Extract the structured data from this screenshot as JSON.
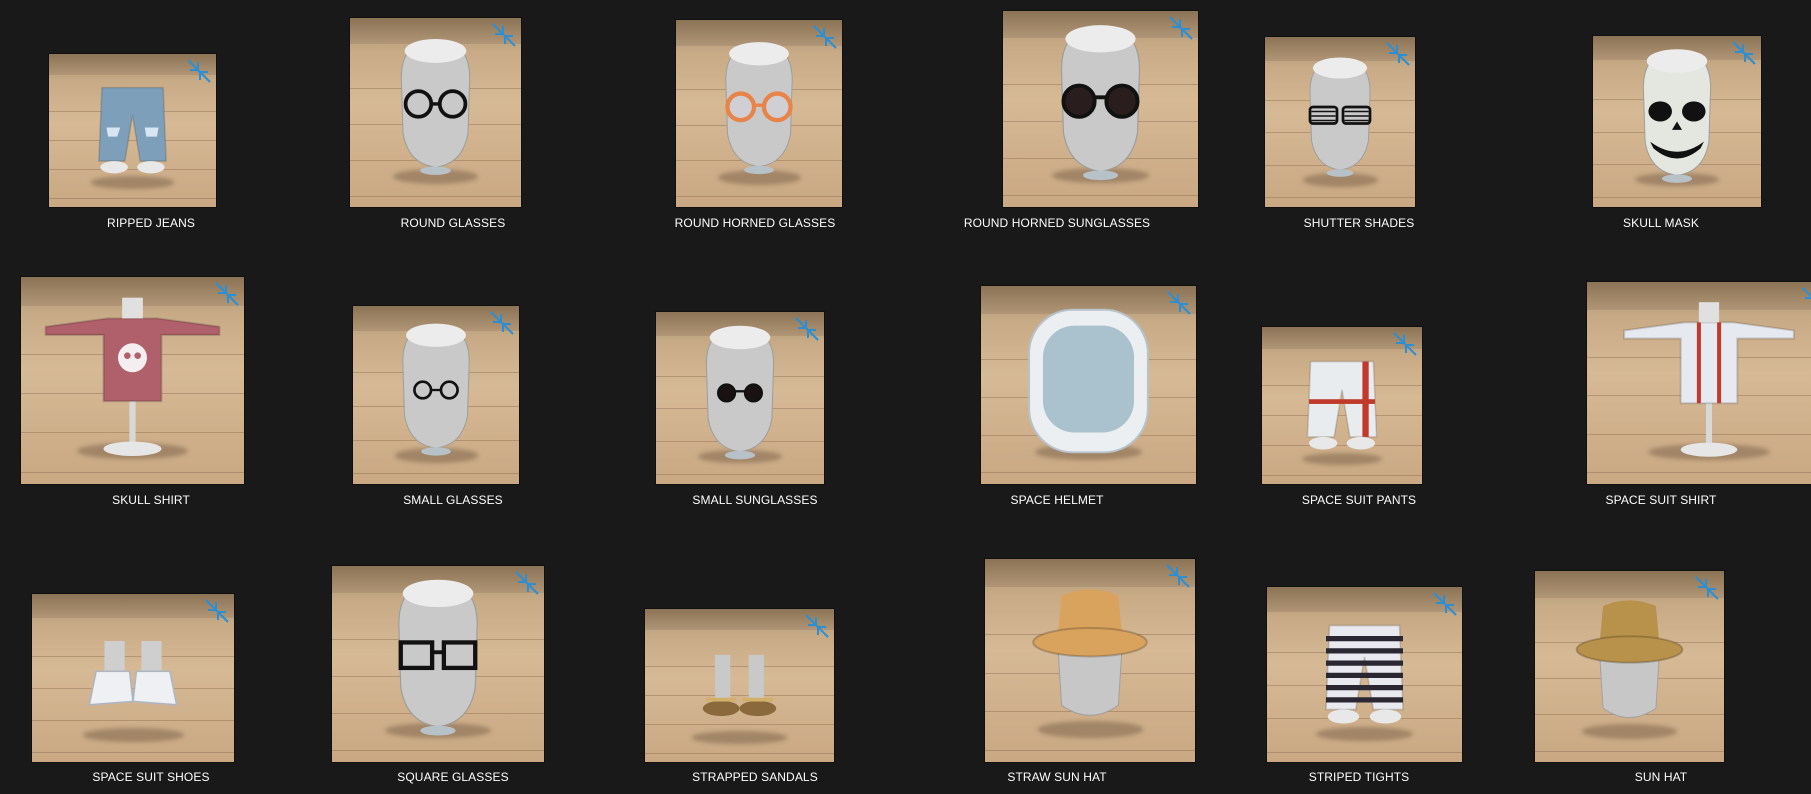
{
  "app": {
    "view": "file-explorer-thumbnail-grid",
    "badge_icon": "shrink-arrows-icon",
    "colors": {
      "background": "#191919",
      "label_text": "#ffffff",
      "badge": "#2b8fd6",
      "floor": "#d6b995"
    }
  },
  "items": [
    {
      "label": "RIPPED JEANS",
      "kind": "pants",
      "variant": "jeans",
      "icon": "ripped-jeans-thumbnail"
    },
    {
      "label": "ROUND GLASSES",
      "kind": "head",
      "variant": "round-glasses",
      "icon": "round-glasses-thumbnail"
    },
    {
      "label": "ROUND HORNED GLASSES",
      "kind": "head",
      "variant": "horned-glasses",
      "icon": "round-horned-glasses-thumbnail"
    },
    {
      "label": "ROUND HORNED SUNGLASSES",
      "kind": "head",
      "variant": "horned-sunglasses",
      "icon": "round-horned-sunglasses-thumbnail"
    },
    {
      "label": "SHUTTER SHADES",
      "kind": "head",
      "variant": "shutter",
      "icon": "shutter-shades-thumbnail"
    },
    {
      "label": "SKULL MASK",
      "kind": "head",
      "variant": "skull",
      "icon": "skull-mask-thumbnail"
    },
    {
      "label": "SKULL SHIRT",
      "kind": "shirt",
      "variant": "skull-shirt",
      "icon": "skull-shirt-thumbnail"
    },
    {
      "label": "SMALL GLASSES",
      "kind": "head",
      "variant": "small-glasses",
      "icon": "small-glasses-thumbnail"
    },
    {
      "label": "SMALL SUNGLASSES",
      "kind": "head",
      "variant": "small-sunglasses",
      "icon": "small-sunglasses-thumbnail"
    },
    {
      "label": "SPACE HELMET",
      "kind": "helmet",
      "variant": "helmet",
      "icon": "space-helmet-thumbnail"
    },
    {
      "label": "SPACE SUIT PANTS",
      "kind": "pants",
      "variant": "space-pants",
      "icon": "space-suit-pants-thumbnail"
    },
    {
      "label": "SPACE SUIT SHIRT",
      "kind": "shirt",
      "variant": "space-shirt",
      "icon": "space-suit-shirt-thumbnail"
    },
    {
      "label": "SPACE SUIT SHOES",
      "kind": "shoes",
      "variant": "space-shoes",
      "icon": "space-suit-shoes-thumbnail"
    },
    {
      "label": "SQUARE GLASSES",
      "kind": "head",
      "variant": "square-glasses",
      "icon": "square-glasses-thumbnail"
    },
    {
      "label": "STRAPPED SANDALS",
      "kind": "shoes",
      "variant": "sandals",
      "icon": "strapped-sandals-thumbnail"
    },
    {
      "label": "STRAW SUN HAT",
      "kind": "hat",
      "variant": "straw-hat",
      "icon": "straw-sun-hat-thumbnail"
    },
    {
      "label": "STRIPED TIGHTS",
      "kind": "pants",
      "variant": "tights",
      "icon": "striped-tights-thumbnail"
    },
    {
      "label": "SUN HAT",
      "kind": "hat",
      "variant": "sun-hat",
      "icon": "sun-hat-thumbnail"
    }
  ]
}
